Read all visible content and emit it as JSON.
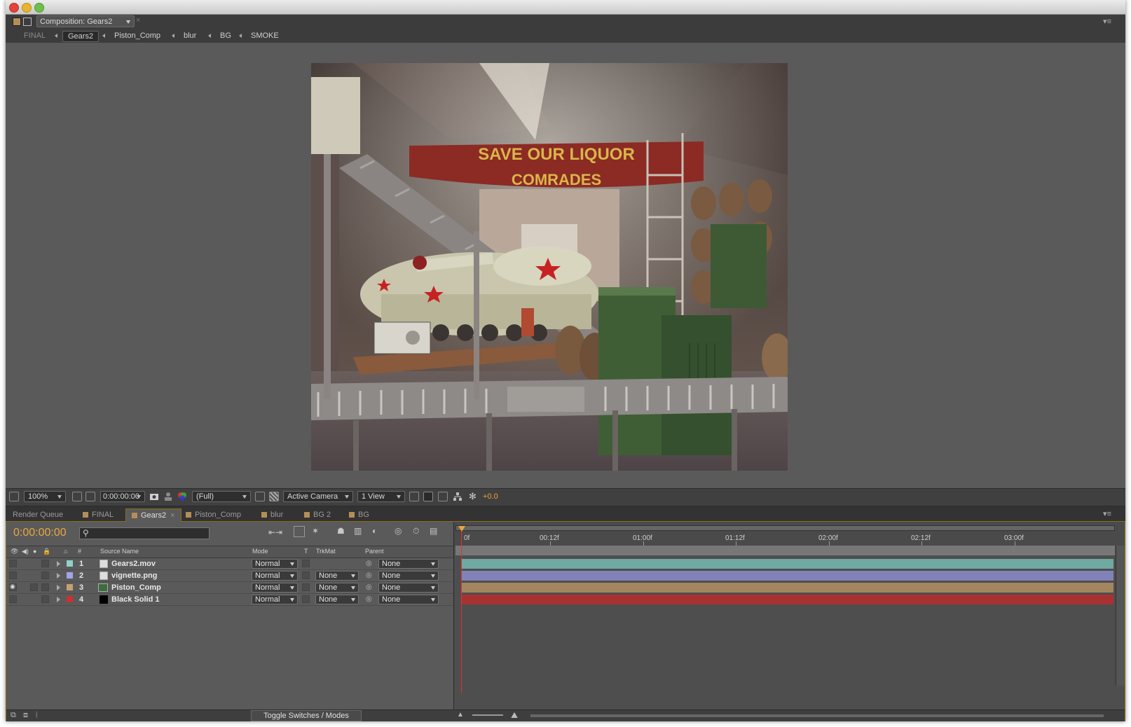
{
  "window": {
    "panel_title": "Composition: Gears2"
  },
  "breadcrumbs": [
    "FINAL",
    "Gears2",
    "Piston_Comp",
    "blur",
    "BG",
    "SMOKE"
  ],
  "viewer": {
    "scene_banner_line1": "SAVE OUR LIQUOR",
    "scene_banner_line2": "COMRADES"
  },
  "viewer_toolbar": {
    "zoom": "100%",
    "timecode": "0:00:00:00",
    "resolution": "(Full)",
    "camera": "Active Camera",
    "view_layout": "1 View",
    "exposure": "+0.0"
  },
  "panel_tabs": [
    "Render Queue",
    "FINAL",
    "Gears2",
    "Piston_Comp",
    "blur",
    "BG 2",
    "BG"
  ],
  "timeline": {
    "current_time": "0:00:00:00",
    "search_placeholder": "",
    "columns": {
      "num": "#",
      "source_name": "Source Name",
      "mode": "Mode",
      "t": "T",
      "trkmat": "TrkMat",
      "parent": "Parent"
    },
    "ruler_ticks": [
      "0f",
      "00:12f",
      "01:00f",
      "01:12f",
      "02:00f",
      "02:12f",
      "03:00f"
    ],
    "layers": [
      {
        "num": "1",
        "name": "Gears2.mov",
        "mode": "Normal",
        "trkmat": "",
        "parent": "None",
        "label_color": "#8fd0c8",
        "bar_color": "#6fa9a2",
        "visible": false
      },
      {
        "num": "2",
        "name": "vignette.png",
        "mode": "Normal",
        "trkmat": "None",
        "parent": "None",
        "label_color": "#a3a3e8",
        "bar_color": "#8282b8",
        "visible": false
      },
      {
        "num": "3",
        "name": "Piston_Comp",
        "mode": "Normal",
        "trkmat": "None",
        "parent": "None",
        "label_color": "#c8a070",
        "bar_color": "#a38560",
        "visible": true
      },
      {
        "num": "4",
        "name": "Black Solid 1",
        "mode": "Normal",
        "trkmat": "None",
        "parent": "None",
        "label_color": "#cc3030",
        "bar_color": "#a83232",
        "visible": false
      }
    ],
    "toggle_label": "Toggle Switches / Modes"
  },
  "colors": {
    "accent": "#e8a73a",
    "panel_bg": "#5a5a5a"
  }
}
